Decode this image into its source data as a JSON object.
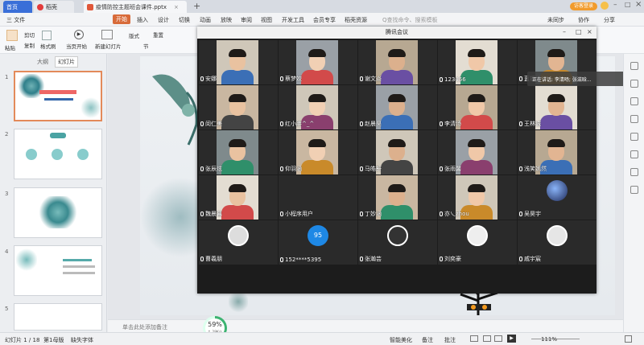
{
  "titlebar": {
    "tabs": [
      {
        "label": "首页",
        "color": "#3a6fd8"
      },
      {
        "label": "稻壳",
        "color": "#e33b3b"
      },
      {
        "label": "疫情防控主题班会课件.pptx",
        "color": "#e0573a"
      }
    ],
    "login_label": "访客登录"
  },
  "menubar": {
    "file_label": "三 文件",
    "items": [
      "开始",
      "插入",
      "设计",
      "切换",
      "动画",
      "放映",
      "审阅",
      "视图",
      "开发工具",
      "会员专享",
      "稻壳资源"
    ],
    "search_placeholder": "Q查找命令、搜索模板",
    "sync_label": "未同步",
    "collab_label": "协作",
    "share_label": "分享"
  },
  "ribbon": {
    "cut": "剪切",
    "paste": "粘贴",
    "copy": "复制",
    "format_painter": "格式刷",
    "from_current": "当页开始",
    "new_slide": "新建幻灯片",
    "layout": "版式",
    "section": "节",
    "reset": "重置"
  },
  "leftpanel": {
    "tab_outline": "大纲",
    "tab_slides": "幻灯片",
    "slide_numbers": [
      "1",
      "2",
      "3",
      "4",
      "5"
    ]
  },
  "meeting": {
    "title": "腾讯会议",
    "speaking": "正在讲话: 李清旸; 张滋晗...",
    "participants": [
      "安娜",
      "蔡梦姣",
      "谢文焱",
      "123456",
      "蓝振阳",
      "闵仁美",
      "红小胖^_^",
      "赵晨昊",
      "李清旸",
      "王林诚",
      "张辰炫",
      "仰羽涵",
      "马皓轩",
      "张雨馨",
      "浅笑嫣然",
      "魏晨暮",
      "小程序用户",
      "丁妙涵",
      "亦乀zhou",
      "吴昊宇",
      "曹羲朋",
      "152****5395",
      "张瀚芸",
      "刘奕豪",
      "戚宇宸"
    ],
    "badge_95": "95"
  },
  "notes": {
    "placeholder": "单击此处添加备注"
  },
  "statusbar": {
    "slide_counter": "幻灯片 1 / 18",
    "theme": "第1母版",
    "missing_font": "缺失字体",
    "beautify": "智能美化",
    "notes": "备注",
    "annotation": "批注",
    "zoom": "111%",
    "progress_value": "59%",
    "progress_sub": "↑ 29K/s"
  }
}
